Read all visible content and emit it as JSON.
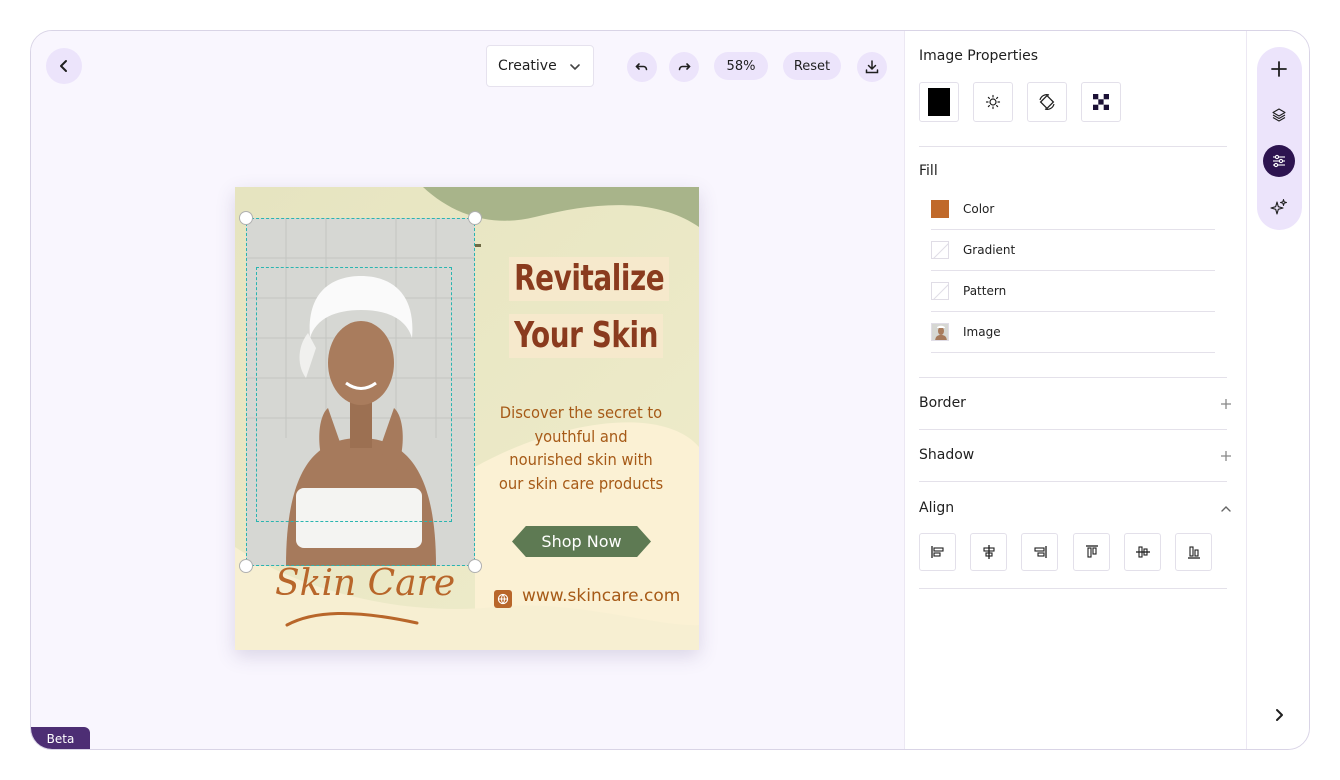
{
  "toolbar": {
    "template_select": "Creative",
    "zoom": "58%",
    "reset_label": "Reset"
  },
  "design": {
    "headline_line1": "Revitalize",
    "headline_line2": "Your Skin",
    "tagline_lines": [
      "Discover the secret to",
      "youthful and",
      "nourished skin with",
      "our skin care products"
    ],
    "cta_label": "Shop Now",
    "brand_text": "Skin Care",
    "website": "www.skincare.com"
  },
  "beta_label": "Beta",
  "panel": {
    "title": "Image Properties",
    "fill_label": "Fill",
    "fill_options": [
      {
        "label": "Color",
        "swatch": "#c0692a"
      },
      {
        "label": "Gradient",
        "swatch": "none"
      },
      {
        "label": "Pattern",
        "swatch": "none"
      },
      {
        "label": "Image",
        "swatch": "image"
      }
    ],
    "border_label": "Border",
    "shadow_label": "Shadow",
    "align_label": "Align"
  },
  "colors": {
    "accent": "#2d1450",
    "accent_light": "#ece4fb",
    "selection": "#2ab5b0"
  }
}
